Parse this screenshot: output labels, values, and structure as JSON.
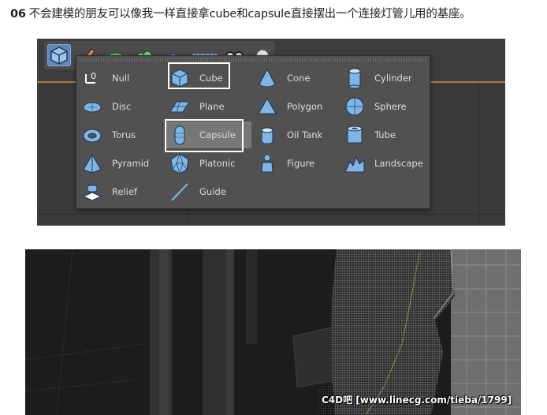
{
  "caption": {
    "number": "06",
    "text": "不会建模的朋友可以像我一样直接拿cube和capsule直接摆出一个连接灯管儿用的基座。"
  },
  "toolbar": {
    "icons": [
      "cube-icon",
      "pen-icon",
      "spline-icon",
      "nurbs-icon",
      "deformer-icon",
      "floor-icon",
      "camera-icon",
      "light-icon"
    ]
  },
  "menu": {
    "columns": [
      [
        {
          "label": "Null",
          "icon": "null-icon"
        },
        {
          "label": "Disc",
          "icon": "disc-icon"
        },
        {
          "label": "Torus",
          "icon": "torus-icon"
        },
        {
          "label": "Pyramid",
          "icon": "pyramid-icon"
        },
        {
          "label": "Relief",
          "icon": "relief-icon"
        }
      ],
      [
        {
          "label": "Cube",
          "icon": "cube-icon"
        },
        {
          "label": "Plane",
          "icon": "plane-icon"
        },
        {
          "label": "Capsule",
          "icon": "capsule-icon"
        },
        {
          "label": "Platonic",
          "icon": "platonic-icon"
        },
        {
          "label": "Guide",
          "icon": "guide-icon"
        }
      ],
      [
        {
          "label": "Cone",
          "icon": "cone-icon"
        },
        {
          "label": "Polygon",
          "icon": "polygon-icon"
        },
        {
          "label": "Oil Tank",
          "icon": "oil-tank-icon"
        },
        {
          "label": "Figure",
          "icon": "figure-icon"
        }
      ],
      [
        {
          "label": "Cylinder",
          "icon": "cylinder-icon"
        },
        {
          "label": "Sphere",
          "icon": "sphere-icon"
        },
        {
          "label": "Tube",
          "icon": "tube-icon"
        },
        {
          "label": "Landscape",
          "icon": "landscape-icon"
        }
      ]
    ],
    "highlighted": "Capsule",
    "annotated": [
      "Cube",
      "Capsule"
    ]
  },
  "watermark": "C4D吧 [www.linecg.com/tieba/1799]",
  "colors": {
    "menu_bg": "#515151",
    "highlight_bg": "#777777",
    "toolbar_active": "#5f88b8",
    "icon_blue": "#7fb6e6",
    "annotation_border": "#ffffff",
    "viewport_orange": "#b5783e"
  }
}
